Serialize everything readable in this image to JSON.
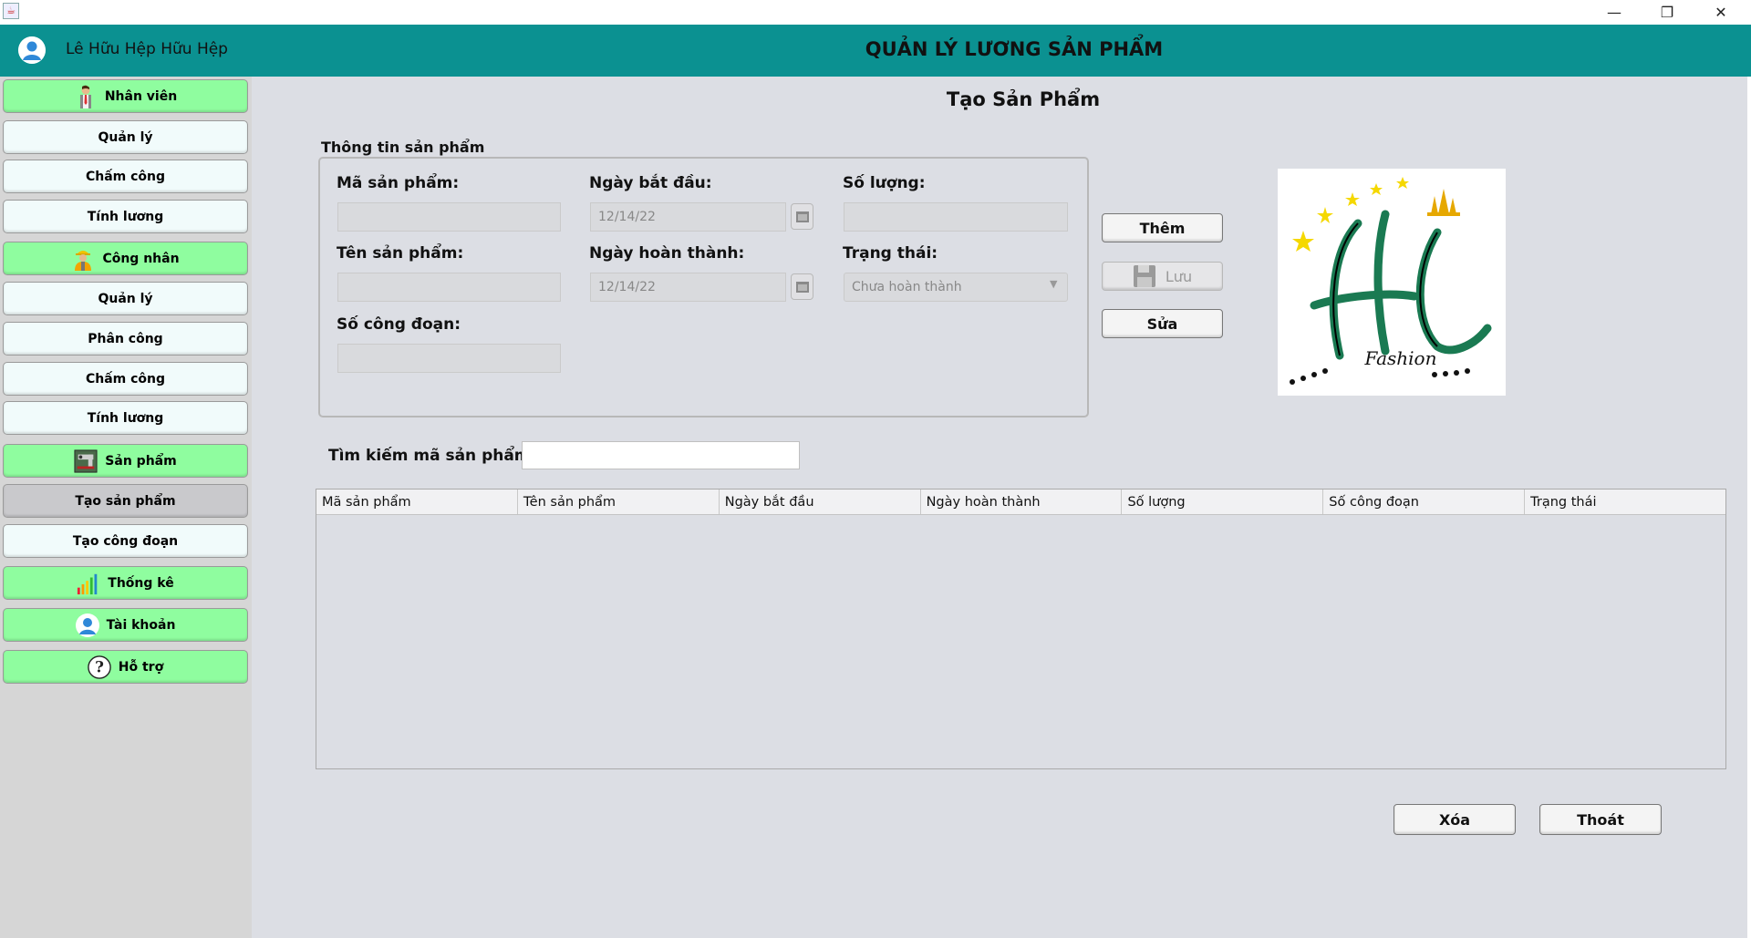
{
  "window": {
    "minimize": "—",
    "restore": "❐",
    "close": "✕"
  },
  "header": {
    "user_name": "Lê Hữu Hệp Hữu Hệp",
    "app_title": "QUẢN LÝ LƯƠNG SẢN PHẨM"
  },
  "sidebar": {
    "nhan_vien": "Nhân viên",
    "nv_quan_ly": "Quản lý",
    "nv_cham_cong": "Chấm công",
    "nv_tinh_luong": "Tính lương",
    "cong_nhan": "Công nhân",
    "cn_quan_ly": "Quản lý",
    "cn_phan_cong": "Phân công",
    "cn_cham_cong": "Chấm công",
    "cn_tinh_luong": "Tính lương",
    "san_pham": "Sản phẩm",
    "sp_tao_san_pham": "Tạo sản phẩm",
    "sp_tao_cong_doan": "Tạo công đoạn",
    "thong_ke": "Thống kê",
    "tai_khoan": "Tài khoản",
    "ho_tro": "Hỗ trợ"
  },
  "main": {
    "heading": "Tạo Sản Phẩm",
    "legend": "Thông tin sản phẩm",
    "ma_sp_label": "Mã sản phẩm:",
    "ten_sp_label": "Tên sản phẩm:",
    "so_cong_doan_label": "Số công đoạn:",
    "ngay_bat_dau_label": "Ngày bắt đầu:",
    "ngay_bat_dau_value": "12/14/22",
    "ngay_hoan_thanh_label": "Ngày hoàn thành:",
    "ngay_hoan_thanh_value": "12/14/22",
    "so_luong_label": "Số lượng:",
    "trang_thai_label": "Trạng thái:",
    "trang_thai_value": "Chưa hoàn thành",
    "btn_them": "Thêm",
    "btn_luu": "Lưu",
    "btn_sua": "Sửa",
    "search_label": "Tìm kiếm mã sản phẩm:",
    "btn_xoa": "Xóa",
    "btn_thoat": "Thoát"
  },
  "logo": {
    "text": "Fashion"
  },
  "table": {
    "columns": [
      "Mã sản phẩm",
      "Tên sản phẩm",
      "Ngày bắt đầu",
      "Ngày hoàn thành",
      "Số lượng",
      "Số công đoạn",
      "Trạng thái"
    ],
    "rows": []
  },
  "colors": {
    "header_bg": "#0b9191",
    "category_bg": "#8ffd9f",
    "sub_bg": "#f1fbfb",
    "active_bg": "#c9c9cc",
    "logo_green": "#1a7a52",
    "star_yellow": "#f5d800"
  }
}
